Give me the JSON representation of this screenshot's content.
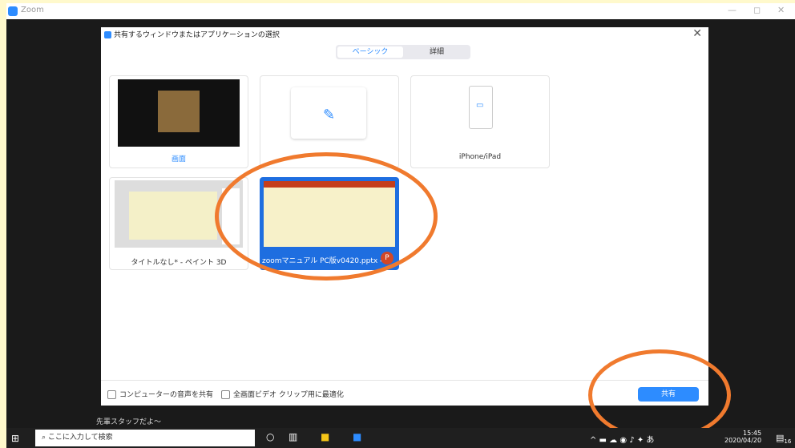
{
  "window": {
    "title": "Zoom",
    "minimize": "—",
    "maximize": "◻",
    "close": "✕"
  },
  "dialog": {
    "title": "共有するウィンドウまたはアプリケーションの選択",
    "close": "✕",
    "tabs": [
      {
        "label": "ベーシック"
      },
      {
        "label": "詳細"
      }
    ]
  },
  "cards": [
    {
      "label": "画面"
    },
    {
      "label": ""
    },
    {
      "label": "iPhone/iPad"
    },
    {
      "label": "タイトルなし* - ペイント 3D"
    },
    {
      "label": "zoomマニュアル PC版v0420.pptx - ..."
    }
  ],
  "footer": {
    "audio_label": "コンピューターの音声を共有",
    "video_label": "全画面ビデオ クリップ用に最適化",
    "share_button": "共有"
  },
  "caption": "先輩スタッフだよ〜",
  "taskbar": {
    "search_placeholder": "ここに入力して検索",
    "time": "15:45",
    "date": "2020/04/20",
    "ime": "あ",
    "notifications": "16"
  },
  "colors": {
    "accent": "#2d8cff",
    "highlight": "#f07a2e",
    "background": "#fff9cc"
  }
}
